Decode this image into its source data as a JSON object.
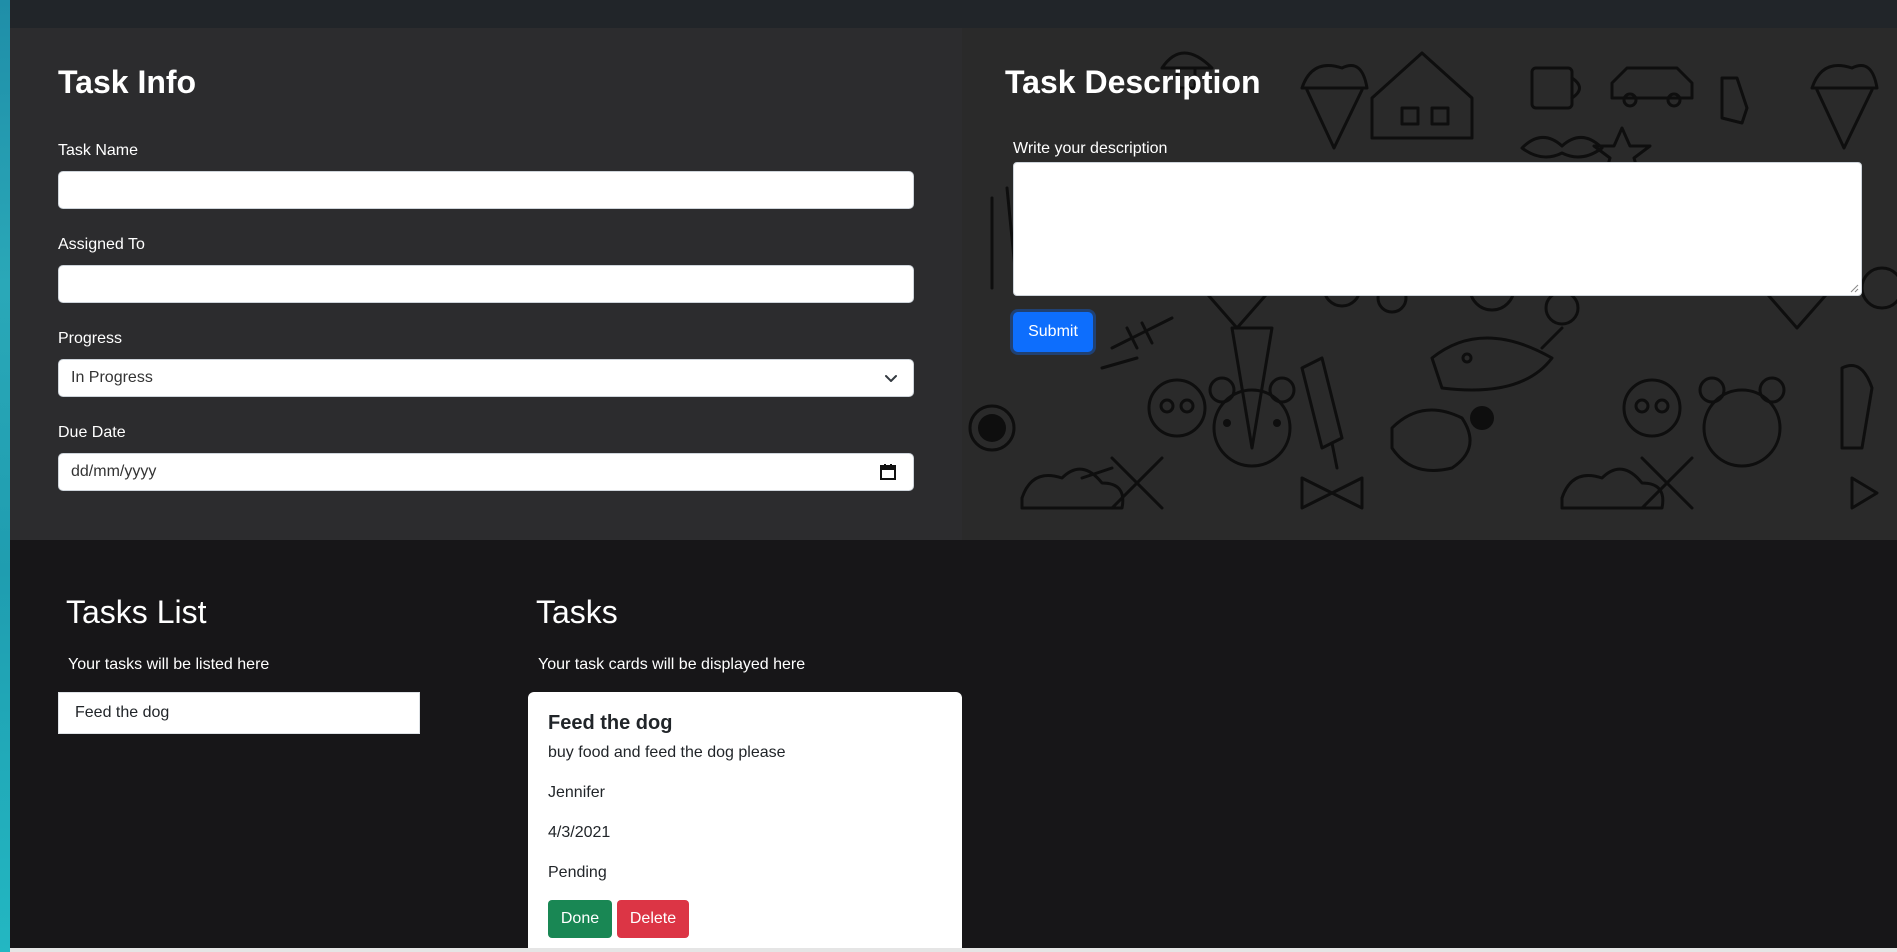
{
  "task_info": {
    "title": "Task Info",
    "task_name_label": "Task Name",
    "task_name_value": "",
    "assigned_to_label": "Assigned To",
    "assigned_to_value": "",
    "progress_label": "Progress",
    "progress_selected": "In Progress",
    "due_date_label": "Due Date",
    "due_date_placeholder": "dd/mm/yyyy"
  },
  "task_description": {
    "title": "Task Description",
    "textarea_label": "Write your description",
    "textarea_value": "",
    "submit_label": "Submit"
  },
  "tasks_list": {
    "title": "Tasks List",
    "subtitle": "Your tasks will be listed here",
    "items": [
      "Feed the dog"
    ]
  },
  "tasks": {
    "title": "Tasks",
    "subtitle": "Your task cards will be displayed here",
    "cards": [
      {
        "name": "Feed the dog",
        "description": "buy food and feed the dog please",
        "assigned_to": "Jennifer",
        "due_date": "4/3/2021",
        "status": "Pending",
        "done_label": "Done",
        "delete_label": "Delete"
      }
    ]
  },
  "colors": {
    "primary": "#0d6efd",
    "success": "#198754",
    "danger": "#dc3545"
  }
}
